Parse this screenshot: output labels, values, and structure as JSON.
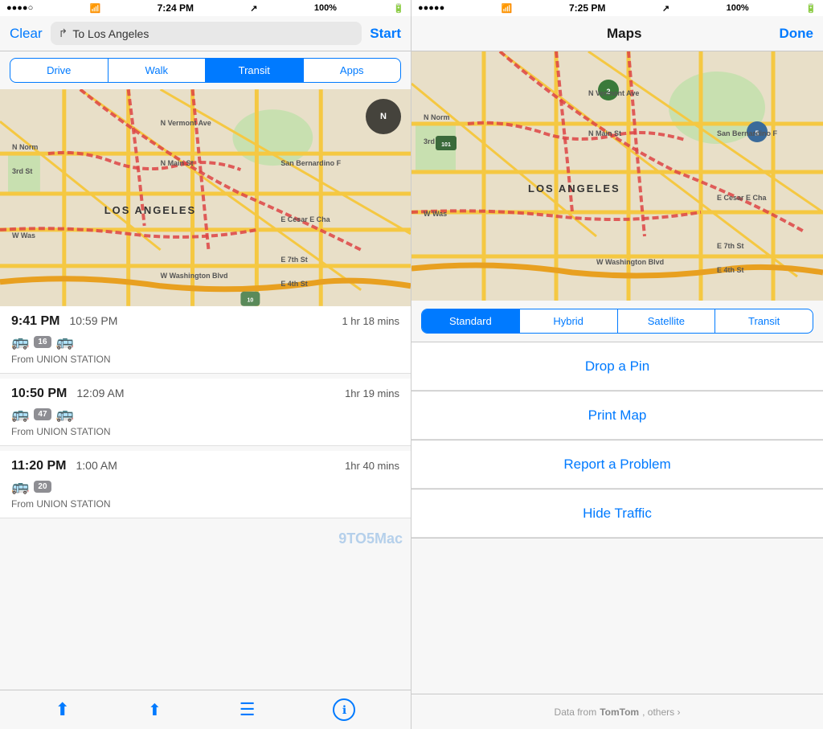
{
  "left": {
    "statusBar": {
      "dots": "●●●●○",
      "wifi": "wifi",
      "time": "7:24 PM",
      "arrow": "↗",
      "battery": "100%"
    },
    "navBar": {
      "clearLabel": "Clear",
      "destinationLabel": "To Los Angeles",
      "startLabel": "Start"
    },
    "segmentControl": {
      "options": [
        "Drive",
        "Walk",
        "Transit",
        "Apps"
      ],
      "activeIndex": 2
    },
    "transitRoutes": [
      {
        "depart": "9:41 PM",
        "arrive": "10:59 PM",
        "duration": "1 hr 18 mins",
        "busNumbers": [
          "16"
        ],
        "from": "From UNION STATION"
      },
      {
        "depart": "10:50 PM",
        "arrive": "12:09 AM",
        "duration": "1hr 19 mins",
        "busNumbers": [
          "47"
        ],
        "from": "From UNION STATION"
      },
      {
        "depart": "11:20 PM",
        "arrive": "1:00 AM",
        "duration": "1hr 40 mins",
        "busNumbers": [
          "20"
        ],
        "from": "From UNION STATION"
      }
    ],
    "toolbar": {
      "locationIcon": "⬆",
      "shareIcon": "↑",
      "listIcon": "≡",
      "infoIcon": "ℹ"
    }
  },
  "right": {
    "statusBar": {
      "dots": "●●●●●",
      "wifi": "wifi",
      "time": "7:25 PM",
      "arrow": "↗",
      "battery": "100%"
    },
    "navBar": {
      "title": "Maps",
      "doneLabel": "Done"
    },
    "mapTypeSegment": {
      "options": [
        "Standard",
        "Hybrid",
        "Satellite",
        "Transit"
      ],
      "activeIndex": 0
    },
    "menuItems": [
      "Drop a Pin",
      "Print Map",
      "Report a Problem",
      "Hide Traffic"
    ],
    "footer": {
      "prefix": "Data from",
      "brand": "TOMTOM",
      "suffix": ", others >"
    }
  },
  "watermark": "9TO5Mac"
}
